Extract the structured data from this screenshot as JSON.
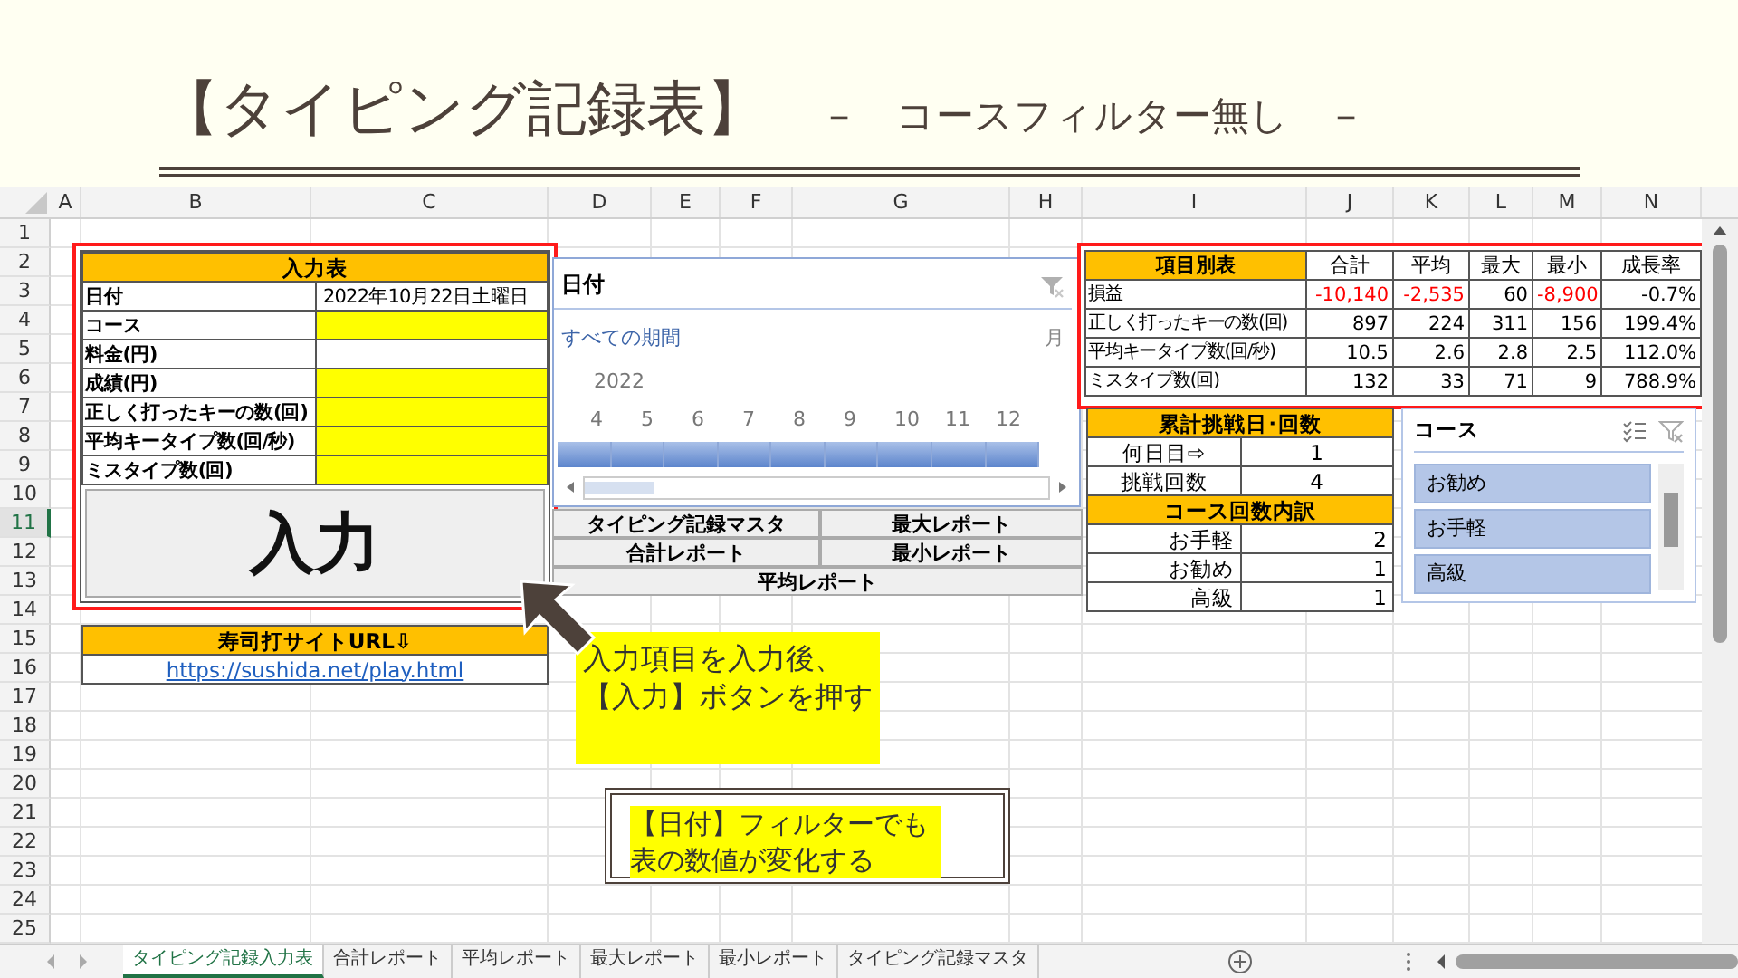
{
  "slide": {
    "title": "【タイピング記録表】",
    "subtitle": "－　コースフィルター無し　－"
  },
  "sheet": {
    "columns": [
      "A",
      "B",
      "C",
      "D",
      "E",
      "F",
      "G",
      "H",
      "I",
      "J",
      "K",
      "L",
      "M",
      "N"
    ],
    "rows": [
      {
        "label": "1",
        "selected": false
      },
      {
        "label": "2",
        "selected": false
      },
      {
        "label": "3",
        "selected": false
      },
      {
        "label": "4",
        "selected": false
      },
      {
        "label": "5",
        "selected": false
      },
      {
        "label": "6",
        "selected": false
      },
      {
        "label": "7",
        "selected": false
      },
      {
        "label": "8",
        "selected": false
      },
      {
        "label": "9",
        "selected": false
      },
      {
        "label": "10",
        "selected": false
      },
      {
        "label": "11",
        "selected": true
      },
      {
        "label": "12",
        "selected": false
      },
      {
        "label": "13",
        "selected": false
      },
      {
        "label": "14",
        "selected": false
      },
      {
        "label": "15",
        "selected": false
      },
      {
        "label": "16",
        "selected": false
      },
      {
        "label": "17",
        "selected": false
      },
      {
        "label": "18",
        "selected": false
      },
      {
        "label": "19",
        "selected": false
      },
      {
        "label": "20",
        "selected": false
      },
      {
        "label": "21",
        "selected": false
      },
      {
        "label": "22",
        "selected": false
      },
      {
        "label": "23",
        "selected": false
      },
      {
        "label": "24",
        "selected": false
      },
      {
        "label": "25",
        "selected": false
      }
    ]
  },
  "input_table": {
    "title": "入力表",
    "rows": [
      {
        "label": "日付",
        "value": "2022年10月22日土曜日",
        "required": false
      },
      {
        "label": "コース",
        "required": true
      },
      {
        "label": "料金(円)",
        "required": false
      },
      {
        "label": "成績(円)",
        "required": true
      },
      {
        "label": "正しく打ったキーの数(回)",
        "required": true
      },
      {
        "label": "平均キータイプ数(回/秒)",
        "required": true
      },
      {
        "label": "ミスタイプ数(回)",
        "required": true
      }
    ],
    "button": "入力"
  },
  "url_table": {
    "title": "寿司打サイトURL⇩",
    "link": "https://sushida.net/play.html"
  },
  "date_slicer": {
    "title": "日付",
    "period": "すべての期間",
    "unit": "月",
    "year": "2022",
    "months": [
      "4",
      "5",
      "6",
      "7",
      "8",
      "9",
      "10",
      "11",
      "12"
    ]
  },
  "report_buttons": [
    "タイピング記録マスタ",
    "最大レポート",
    "合計レポート",
    "最小レポート",
    "平均レポート"
  ],
  "summary_table": {
    "title": "項目別表",
    "columns": [
      "合計",
      "平均",
      "最大",
      "最小",
      "成長率"
    ],
    "rows": [
      {
        "label": "損益",
        "cells": [
          {
            "text": "-10,140",
            "negative": true
          },
          {
            "text": "-2,535",
            "negative": true
          },
          {
            "text": "60",
            "negative": false
          },
          {
            "text": "-8,900",
            "negative": true
          },
          {
            "text": "-0.7%",
            "negative": false
          }
        ]
      },
      {
        "label": "正しく打ったキーの数(回)",
        "cells": [
          {
            "text": "897",
            "negative": false
          },
          {
            "text": "224",
            "negative": false
          },
          {
            "text": "311",
            "negative": false
          },
          {
            "text": "156",
            "negative": false
          },
          {
            "text": "199.4%",
            "negative": false
          }
        ]
      },
      {
        "label": "平均キータイプ数(回/秒)",
        "cells": [
          {
            "text": "10.5",
            "negative": false
          },
          {
            "text": "2.6",
            "negative": false
          },
          {
            "text": "2.8",
            "negative": false
          },
          {
            "text": "2.5",
            "negative": false
          },
          {
            "text": "112.0%",
            "negative": false
          }
        ]
      },
      {
        "label": "ミスタイプ数(回)",
        "cells": [
          {
            "text": "132",
            "negative": false
          },
          {
            "text": "33",
            "negative": false
          },
          {
            "text": "71",
            "negative": false
          },
          {
            "text": "9",
            "negative": false
          },
          {
            "text": "788.9%",
            "negative": false
          }
        ]
      }
    ]
  },
  "challenge_table": {
    "title": "累計挑戦日･回数",
    "rows": [
      {
        "label": "何日目⇨",
        "value": "1"
      },
      {
        "label": "挑戦回数",
        "value": "4"
      }
    ]
  },
  "course_breakdown": {
    "title": "コース回数内訳",
    "rows": [
      {
        "label": "お手軽",
        "value": "2"
      },
      {
        "label": "お勧め",
        "value": "1"
      },
      {
        "label": "高級",
        "value": "1"
      }
    ]
  },
  "course_slicer": {
    "title": "コース",
    "items": [
      {
        "label": "お勧め",
        "selected": true
      },
      {
        "label": "お手軽",
        "selected": true
      },
      {
        "label": "高級",
        "selected": true
      }
    ]
  },
  "callouts": [
    {
      "kind": "arrow",
      "text": "入力項目を入力後、【入力】ボタンを押す"
    },
    {
      "kind": "framed",
      "text": "【日付】フィルターでも表の数値が変化する"
    }
  ],
  "sheet_tabs": [
    {
      "label": "タイピング記録入力表",
      "selected": true
    },
    {
      "label": "合計レポート",
      "selected": false
    },
    {
      "label": "平均レポート",
      "selected": false
    },
    {
      "label": "最大レポート",
      "selected": false
    },
    {
      "label": "最小レポート",
      "selected": false
    },
    {
      "label": "タイピング記録マスタ",
      "selected": false
    }
  ]
}
